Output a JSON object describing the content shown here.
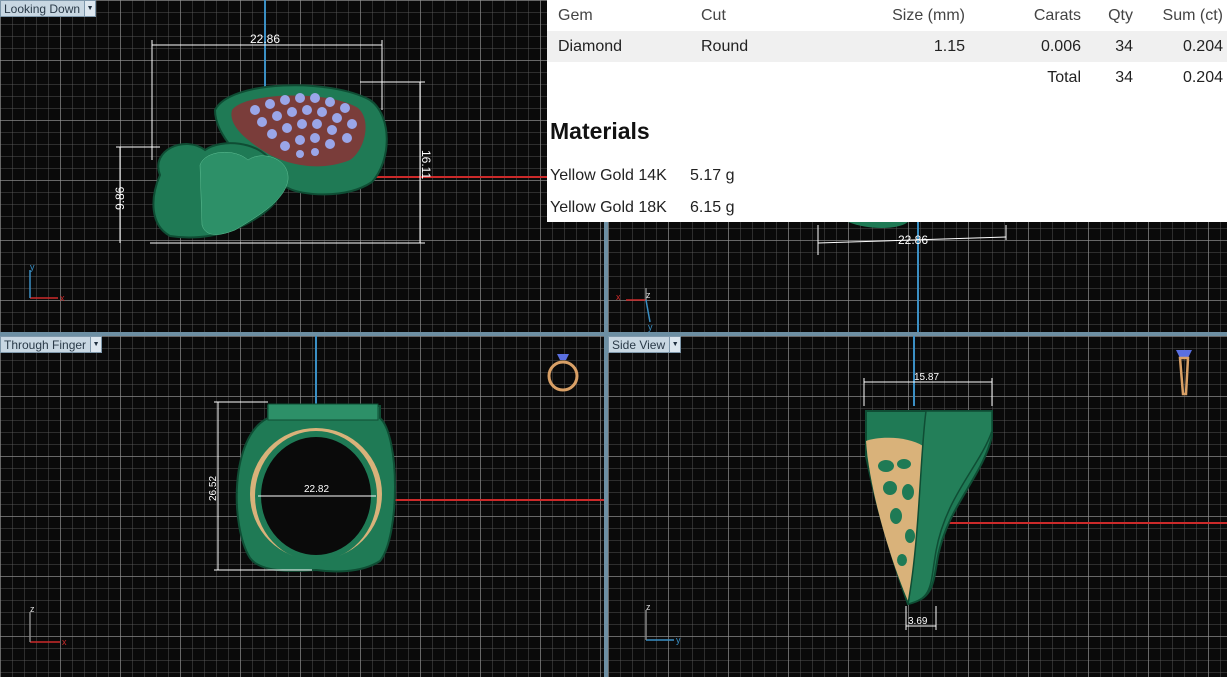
{
  "viewports": {
    "top": {
      "label": "Looking Down",
      "dims": {
        "width": "22.86",
        "height_right": "16.11",
        "height_left": "9.86"
      },
      "axes": {
        "h": "x",
        "v": "y"
      }
    },
    "front": {
      "label": "",
      "dims": {
        "width": "22.86"
      },
      "axes": {
        "h": "x",
        "v": "z",
        "d": "y"
      }
    },
    "through": {
      "label": "Through Finger",
      "dims": {
        "inner": "22.82",
        "height": "26.52"
      },
      "axes": {
        "h": "x",
        "v": "z"
      }
    },
    "side": {
      "label": "Side View",
      "dims": {
        "top": "15.87",
        "bottom": "3.69"
      },
      "axes": {
        "h": "y",
        "v": "z"
      }
    }
  },
  "report": {
    "columns": [
      "Gem",
      "Cut",
      "Size (mm)",
      "Carats",
      "Qty",
      "Sum (ct)"
    ],
    "rows": [
      {
        "gem": "Diamond",
        "cut": "Round",
        "size": "1.15",
        "carats": "0.006",
        "qty": "34",
        "sum": "0.204"
      }
    ],
    "total": {
      "label": "Total",
      "qty": "34",
      "sum": "0.204"
    },
    "materials_title": "Materials",
    "materials": [
      {
        "name": "Yellow Gold 14K",
        "weight": "5.17 g"
      },
      {
        "name": "Yellow Gold 18K",
        "weight": "6.15 g"
      }
    ]
  },
  "colors": {
    "metal_green": "#1f7a55",
    "metal_green_dark": "#0f4d34",
    "gold_wire": "#d9b27a",
    "axis_red": "#cc2a2a",
    "axis_blue": "#3a8fc4",
    "gem_blue": "#9aa6e8"
  },
  "icons": [
    "dropdown-arrow-icon",
    "ring-front-icon",
    "ring-side-icon"
  ]
}
